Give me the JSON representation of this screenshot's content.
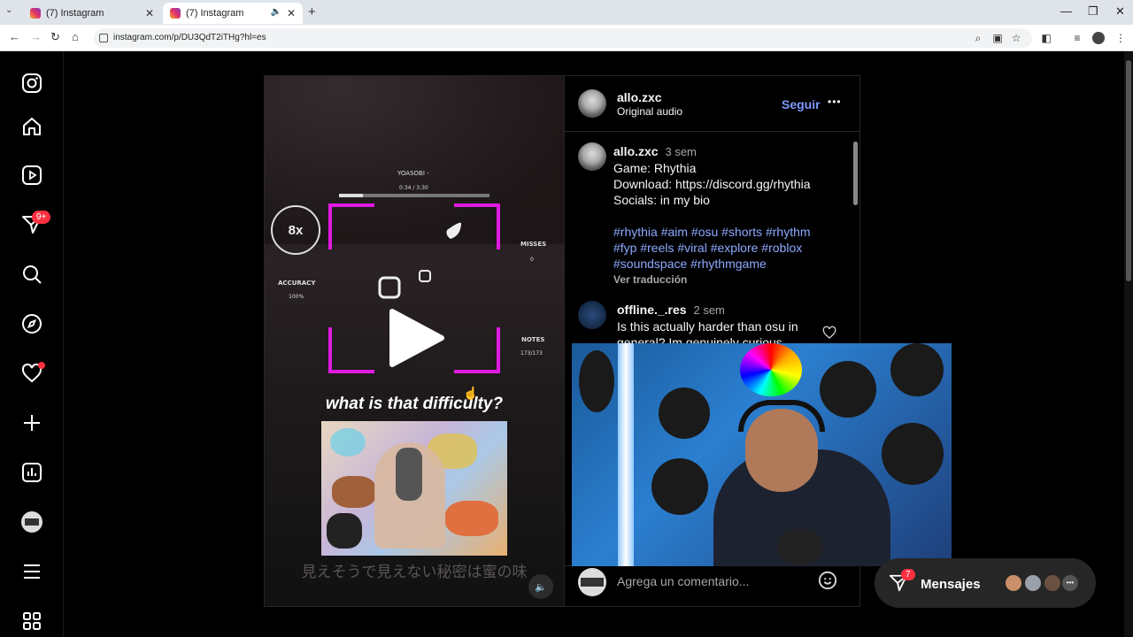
{
  "browser": {
    "tabs": [
      {
        "title": "(7) Instagram"
      },
      {
        "title": "(7) Instagram"
      }
    ],
    "url": "instagram.com/p/DU3QdT2iTHg?hl=es"
  },
  "sidebar": {
    "notifications_badge": "9+"
  },
  "video": {
    "song": "YOASOBI -",
    "time": "0:34 / 3:30",
    "combo": "8x",
    "misses_label": "MISSES",
    "misses_value": "0",
    "accuracy_label": "ACCURACY",
    "accuracy_value": "100%",
    "notes_label": "NOTES",
    "notes_value": "173/173",
    "caption": "what is that difficulty?",
    "lyrics": "見えそうで見えない秘密は蜜の味",
    "progress": 0.16
  },
  "post_header": {
    "username": "allo.zxc",
    "audio": "Original audio",
    "follow_label": "Seguir",
    "more": "•••"
  },
  "caption_comment": {
    "username": "allo.zxc",
    "time": "3 sem",
    "line1": "Game: Rhythia",
    "line2": "Download: https://discord.gg/rhythia",
    "line3": "Socials: in my bio",
    "hashtags_1": "#rhythia #aim #osu #shorts #rhythm",
    "hashtags_2": "#fyp #reels #viral #explore #roblox",
    "hashtags_3": "#soundspace #rhythmgame",
    "translate": "Ver traducción"
  },
  "comment_2": {
    "username": "offline._.res",
    "time": "2 sem",
    "text1": "Is this actually harder than osu in",
    "text2": "general? Im genuinely curious"
  },
  "comment_input": {
    "placeholder": "Agrega un comentario..."
  },
  "messages": {
    "label": "Mensajes",
    "badge": "7",
    "more": "•••"
  }
}
